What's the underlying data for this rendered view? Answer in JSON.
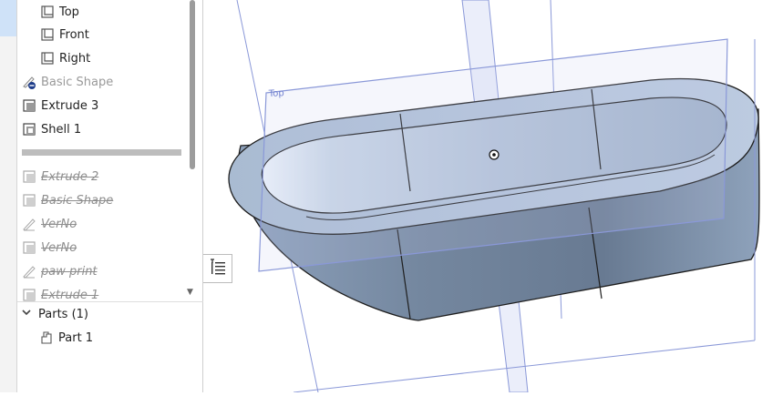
{
  "feature_tree": {
    "planes": [
      {
        "label": "Top",
        "icon": "plane-icon"
      },
      {
        "label": "Front",
        "icon": "plane-icon"
      },
      {
        "label": "Right",
        "icon": "plane-icon"
      }
    ],
    "features": [
      {
        "label": "Basic Shape",
        "icon": "sketch-error-icon",
        "state": "grey"
      },
      {
        "label": "Extrude 3",
        "icon": "extrude-icon",
        "state": "active"
      },
      {
        "label": "Shell 1",
        "icon": "shell-icon",
        "state": "active"
      }
    ],
    "suppressed": [
      {
        "label": "Extrude 2",
        "icon": "extrude-icon"
      },
      {
        "label": "Basic Shape",
        "icon": "extrude-icon"
      },
      {
        "label": "VerNo",
        "icon": "sketch-icon"
      },
      {
        "label": "VerNo",
        "icon": "extrude-icon"
      },
      {
        "label": "paw print",
        "icon": "sketch-icon"
      },
      {
        "label": "Extrude 1",
        "icon": "extrude-icon"
      }
    ]
  },
  "parts": {
    "header": "Parts (1)",
    "items": [
      {
        "label": "Part 1",
        "icon": "part-icon"
      }
    ]
  },
  "viewport": {
    "plane_label": "Top"
  },
  "colors": {
    "plane_stroke": "#8a98d8",
    "body_top": "#b8c8df",
    "body_side": "#7e92ad",
    "selection": "#cfe2f8"
  }
}
